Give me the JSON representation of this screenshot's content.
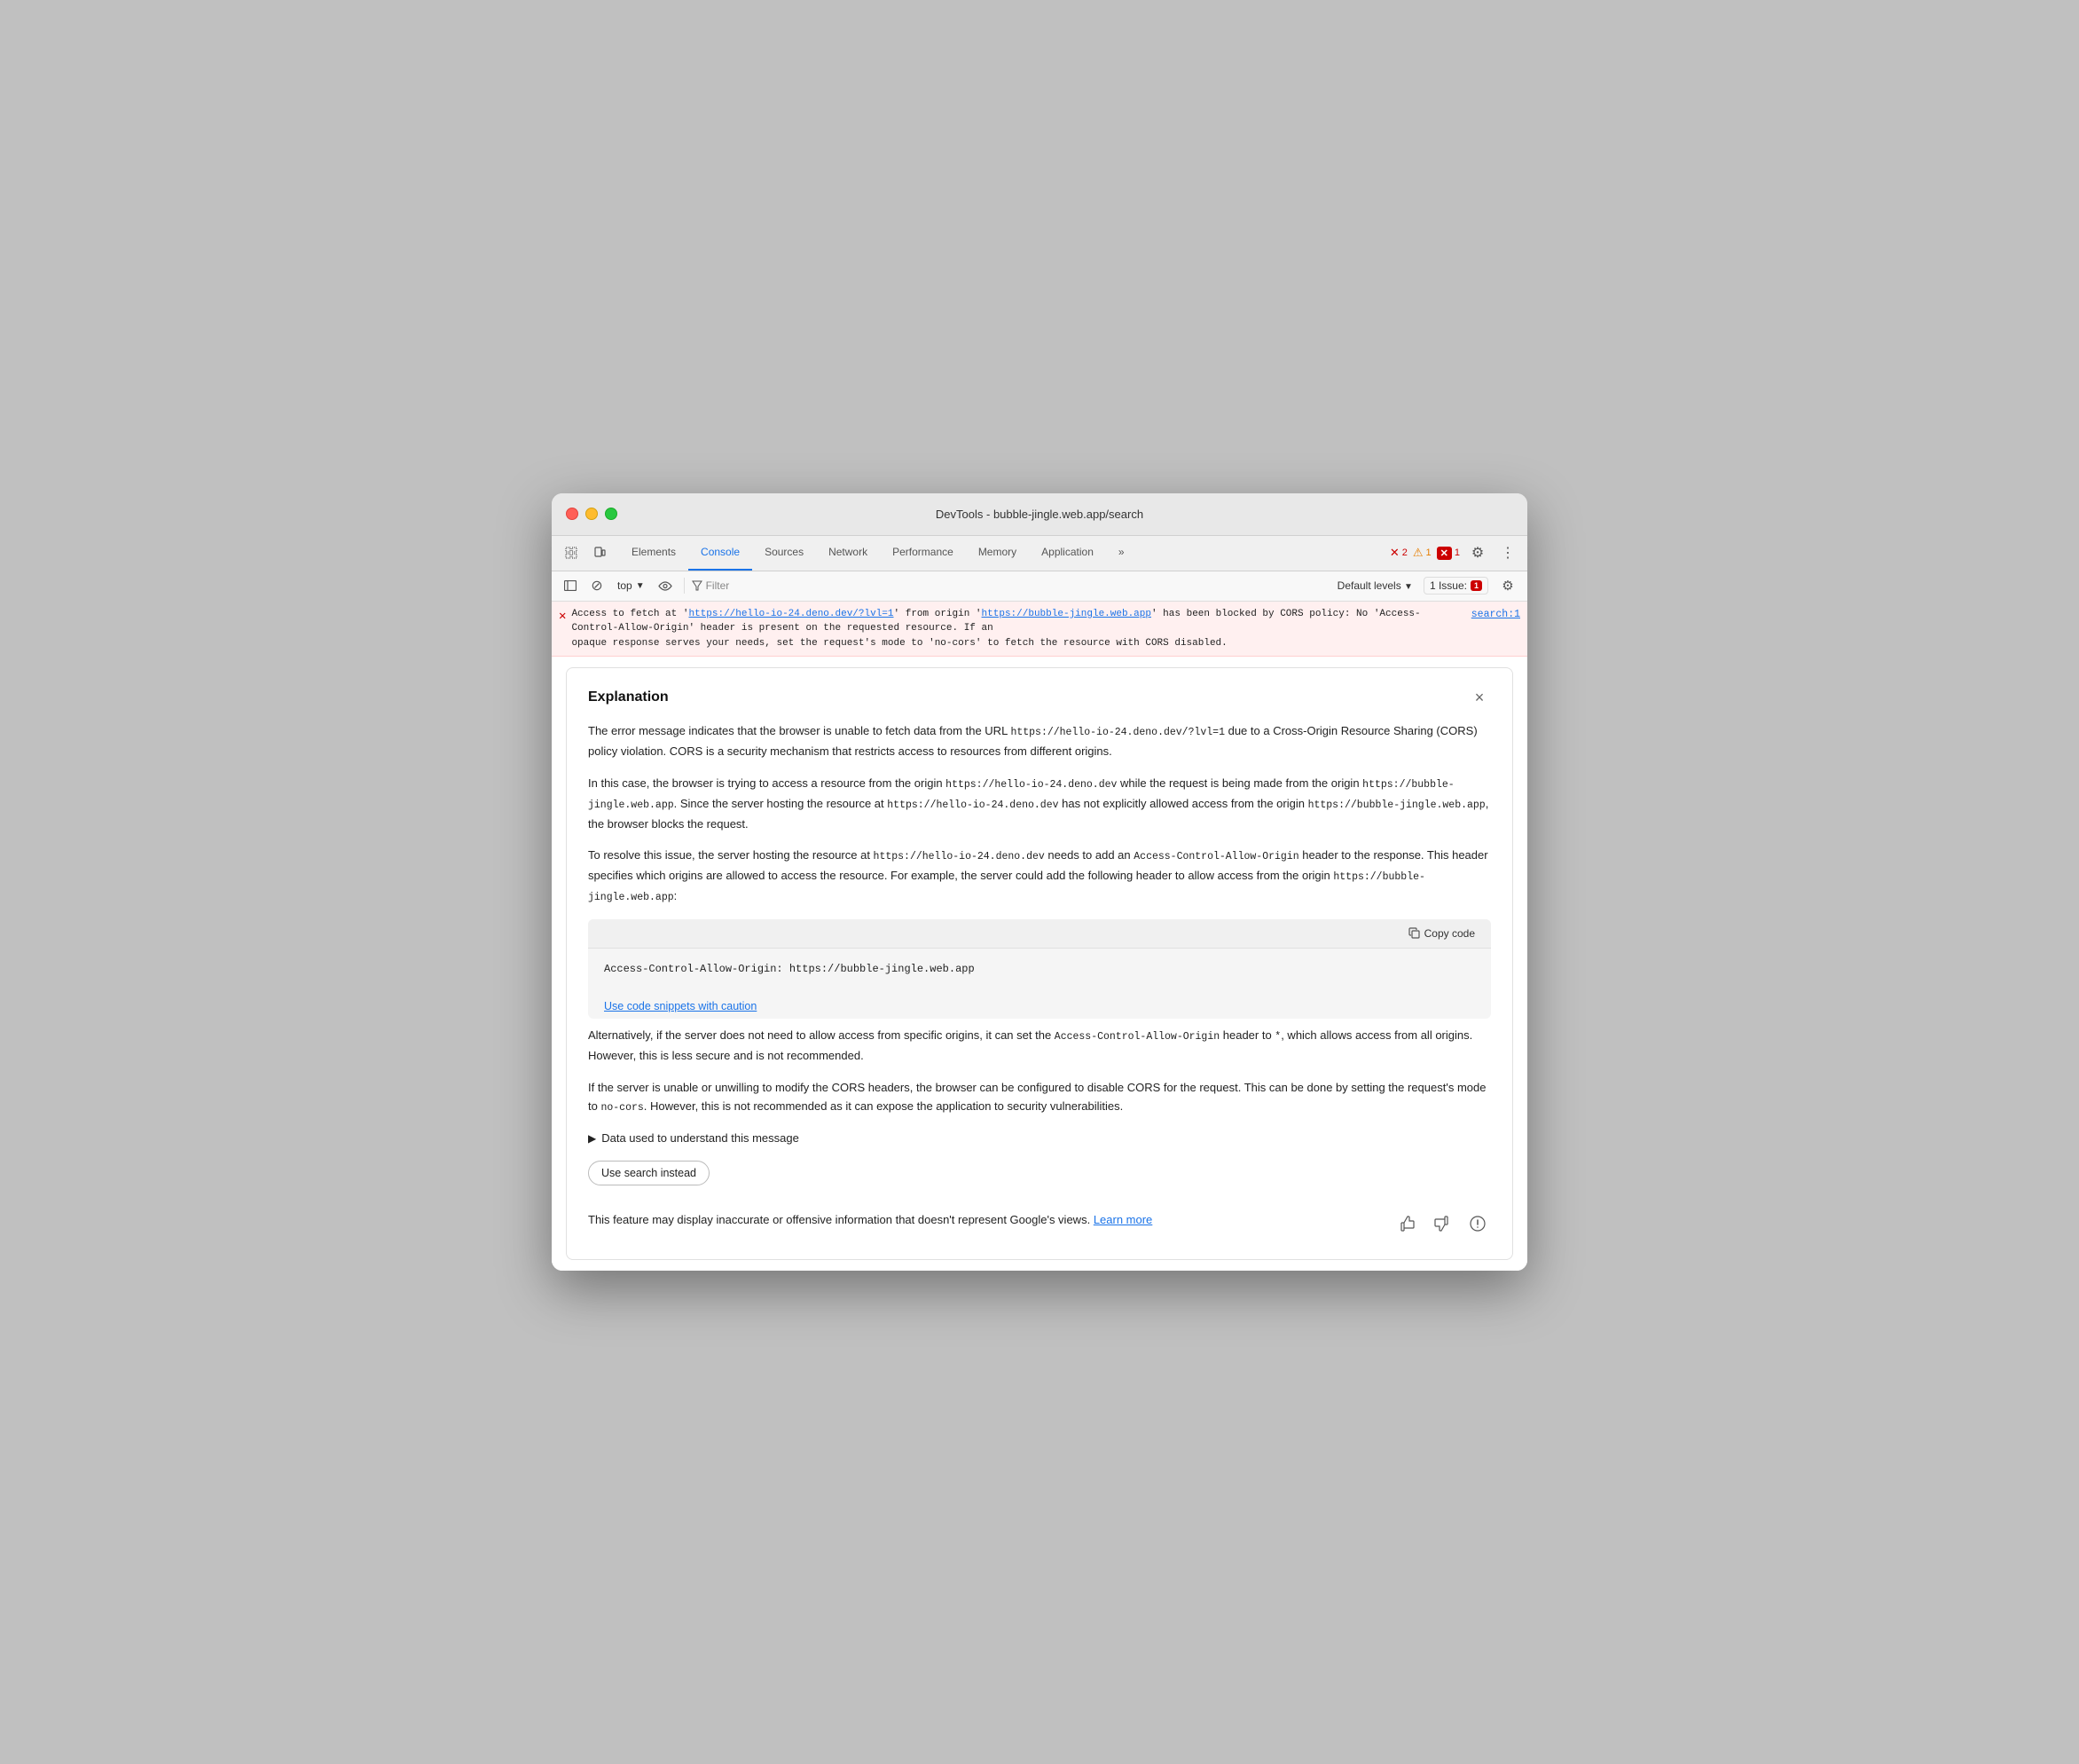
{
  "window": {
    "title": "DevTools - bubble-jingle.web.app/search"
  },
  "tabs": {
    "items": [
      {
        "label": "Elements",
        "active": false
      },
      {
        "label": "Console",
        "active": true
      },
      {
        "label": "Sources",
        "active": false
      },
      {
        "label": "Network",
        "active": false
      },
      {
        "label": "Performance",
        "active": false
      },
      {
        "label": "Memory",
        "active": false
      },
      {
        "label": "Application",
        "active": false
      },
      {
        "label": "»",
        "active": false
      }
    ],
    "badges": {
      "errors": "2",
      "warnings": "1",
      "issues": "1"
    }
  },
  "toolbar": {
    "context": "top",
    "filter_placeholder": "Filter",
    "levels_label": "Default levels",
    "issues_label": "1 Issue:",
    "issues_count": "1"
  },
  "console": {
    "error_message": "Access to fetch at 'https://hello-io-24.deno.dev/?lvl=1' from origin 'https://bubble-jingle.web.app' has been blocked by CORS policy: No 'Access-Control-Allow-Origin' header is present on the requested resource. If an opaque response serves your needs, set the request's mode to 'no-cors' to fetch the resource with CORS disabled.",
    "error_url1": "https://hello-io-24.deno.dev/?lvl=1",
    "error_url2": "https://bubble-jingle.web.app",
    "error_location": "search:1"
  },
  "explanation": {
    "title": "Explanation",
    "close_label": "×",
    "paragraphs": [
      "The error message indicates that the browser is unable to fetch data from the URL https://hello-io-24.deno.dev/?lvl=1 due to a Cross-Origin Resource Sharing (CORS) policy violation. CORS is a security mechanism that restricts access to resources from different origins.",
      "In this case, the browser is trying to access a resource from the origin https://hello-io-24.deno.dev while the request is being made from the origin https://bubble-jingle.web.app. Since the server hosting the resource at https://hello-io-24.deno.dev has not explicitly allowed access from the origin https://bubble-jingle.web.app, the browser blocks the request.",
      "To resolve this issue, the server hosting the resource at https://hello-io-24.deno.dev needs to add an Access-Control-Allow-Origin header to the response. This header specifies which origins are allowed to access the resource. For example, the server could add the following header to allow access from the origin https://bubble-jingle.web.app:"
    ],
    "code_snippet": "Access-Control-Allow-Origin: https://bubble-jingle.web.app",
    "copy_btn_label": "Copy code",
    "caution_link": "Use code snippets with caution",
    "para4": "Alternatively, if the server does not need to allow access from specific origins, it can set the Access-Control-Allow-Origin header to *, which allows access from all origins. However, this is less secure and is not recommended.",
    "para5": "If the server is unable or unwilling to modify the CORS headers, the browser can be configured to disable CORS for the request. This can be done by setting the request's mode to no-cors. However, this is not recommended as it can expose the application to security vulnerabilities.",
    "data_toggle_label": "Data used to understand this message",
    "use_search_label": "Use search instead",
    "footer_text": "This feature may display inaccurate or offensive information that doesn't represent Google's views.",
    "learn_more_label": "Learn more"
  }
}
